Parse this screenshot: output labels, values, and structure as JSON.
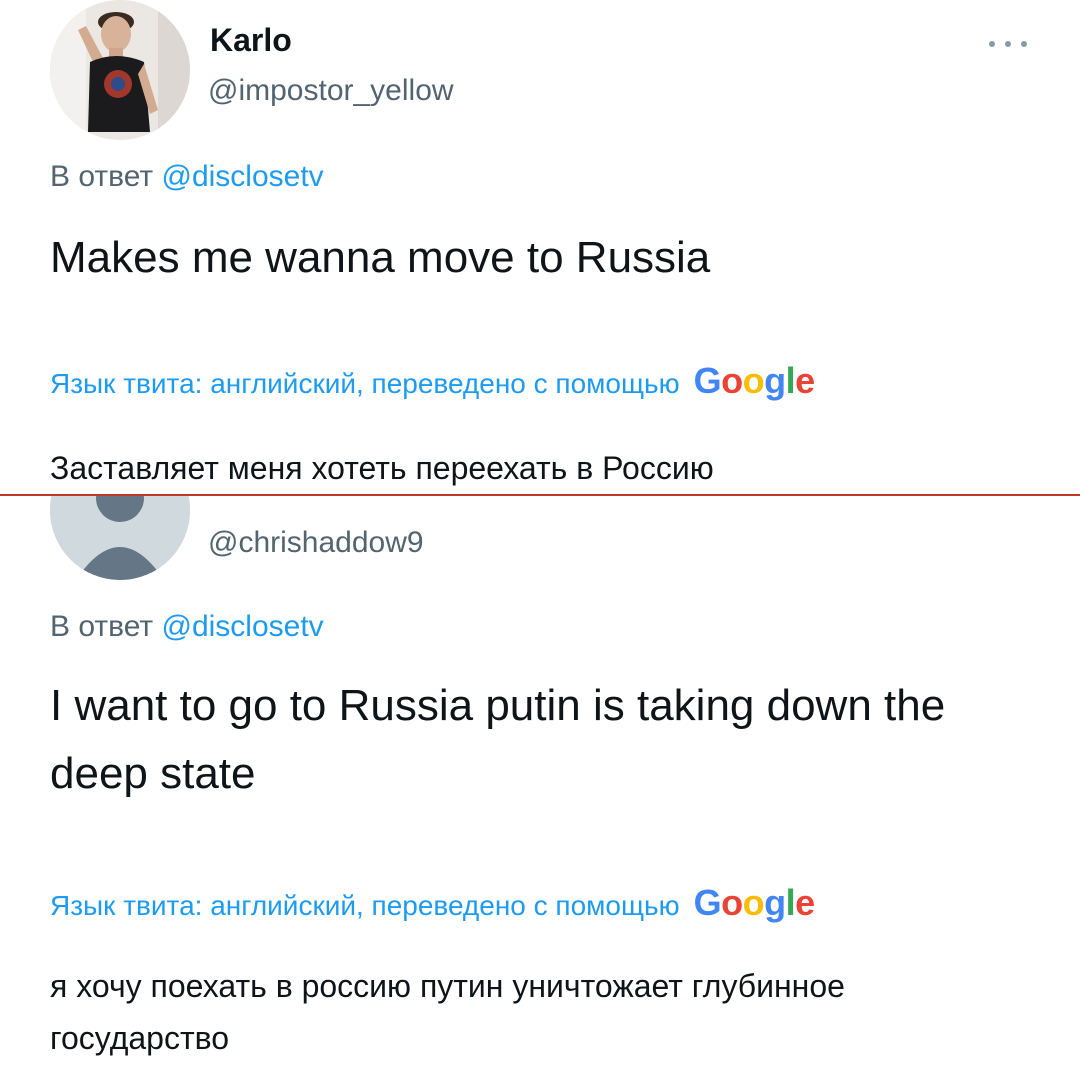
{
  "tweets": [
    {
      "display_name": "Karlo",
      "handle": "@impostor_yellow",
      "reply_prefix": "В ответ ",
      "reply_mention": "@disclosetv",
      "text": "Makes me wanna move to Russia",
      "translation_note": "Язык твита: английский, переведено с помощью",
      "translation_provider": "Google",
      "translated_text": "Заставляет меня хотеть переехать в Россию",
      "avatar_icon": "user-photo-avatar"
    },
    {
      "handle": "@chrishaddow9",
      "reply_prefix": "В ответ ",
      "reply_mention": "@disclosetv",
      "text": "I want to go to Russia putin is taking down the deep state",
      "translation_note": "Язык твита: английский, переведено с помощью",
      "translation_provider": "Google",
      "translated_text": "я хочу поехать в россию путин уничтожает глубинное государство",
      "avatar_icon": "default-user-avatar"
    }
  ],
  "icons": {
    "more": "more-options-icon"
  },
  "colors": {
    "link": "#1d9bf0",
    "secondary_text": "#536471",
    "divider": "#c0392b"
  }
}
